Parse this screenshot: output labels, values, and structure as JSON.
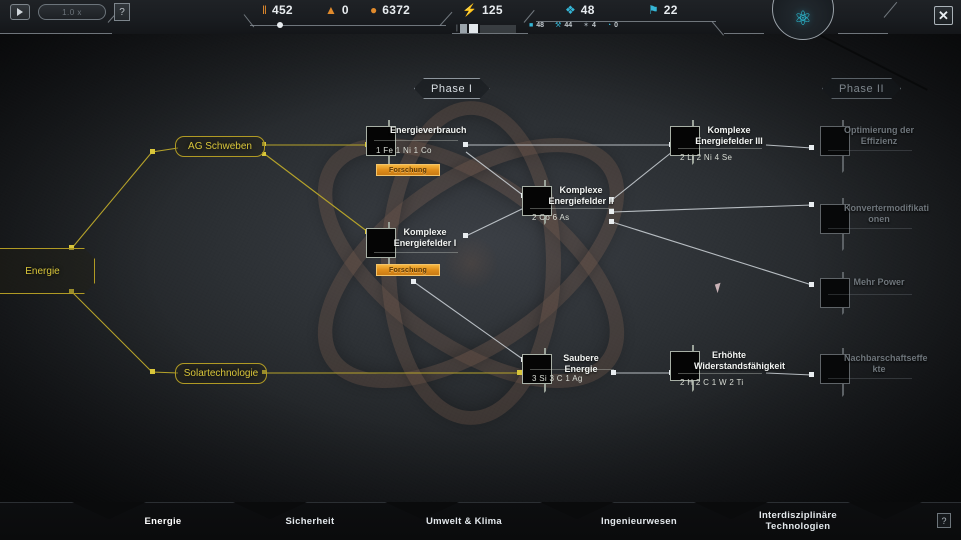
{
  "window": {
    "close_label": "✕",
    "help_label": "?"
  },
  "topbar": {
    "play_icon": "play-icon",
    "speed_value": "1.0 x",
    "help_label": "?",
    "resources": [
      {
        "icon": "population-icon",
        "glyph": "‖",
        "value": "452",
        "color": "#e08a2c"
      },
      {
        "icon": "flame-icon",
        "glyph": "▲",
        "value": "0",
        "color": "#d8841f"
      },
      {
        "icon": "coin-icon",
        "glyph": "●",
        "value": "6372",
        "color": "#d8a12a"
      },
      {
        "icon": "energy-icon",
        "glyph": "⚡",
        "value": "125",
        "color": "#d8a12a"
      },
      {
        "icon": "research-icon",
        "glyph": "❖",
        "value": "48",
        "color": "#35b6d6"
      },
      {
        "icon": "colonist-icon",
        "glyph": "⚑",
        "value": "22",
        "color": "#35b6d6"
      }
    ],
    "sub_resources": [
      {
        "icon": "cube-icon",
        "glyph": "■",
        "value": "48",
        "color": "#35b6d6"
      },
      {
        "icon": "wrench-icon",
        "glyph": "⚒",
        "value": "44",
        "color": "#35b6d6"
      },
      {
        "icon": "spark-icon",
        "glyph": "✶",
        "value": "4",
        "color": "#9aa3aa"
      },
      {
        "icon": "clock-icon",
        "glyph": "◔",
        "value": "0",
        "color": "#35b6d6"
      }
    ],
    "atom_badge_icon": "atom-icon",
    "atom_badge_glyph": "⚛"
  },
  "phases": [
    {
      "label": "Phase I",
      "state": "active"
    },
    {
      "label": "Phase II",
      "state": "locked"
    }
  ],
  "categories": [
    {
      "label": "Energie",
      "name": "category-energie"
    },
    {
      "label": "AG Schweben",
      "name": "category-ag-schweben"
    },
    {
      "label": "Solartechnologie",
      "name": "category-solartechnologie"
    }
  ],
  "tech_nodes": [
    {
      "name": "tech-energieverbrauch",
      "title": "Energieverbrauch",
      "cost": "1 Fe 1 Ni  1 Co",
      "button": "Forschung",
      "state": "available"
    },
    {
      "name": "tech-komplexe-energiefelder-1",
      "title": "Komplexe\nEnergiefelder I",
      "cost": "",
      "button": "Forschung",
      "state": "available"
    },
    {
      "name": "tech-komplexe-energiefelder-2",
      "title": "Komplexe\nEnergiefelder II",
      "cost": "2 Co  6 As",
      "button": "",
      "state": "available"
    },
    {
      "name": "tech-komplexe-energiefelder-3",
      "title": "Komplexe\nEnergiefelder III",
      "cost": "2 Li  2 Ni  4 Se",
      "button": "",
      "state": "available"
    },
    {
      "name": "tech-saubere-energie",
      "title": "Saubere Energie",
      "cost": "3 Si  3 C  1 Ag",
      "button": "",
      "state": "available"
    },
    {
      "name": "tech-erhoehte-widerstandsfaehigkeit",
      "title": "Erhöhte\nWiderstandsfähigkeit",
      "cost": "2 H  2 C  1 W  2 Ti",
      "button": "",
      "state": "available"
    },
    {
      "name": "tech-optimierung-der-effizienz",
      "title": "Optimierung der\nEffizienz",
      "cost": "",
      "button": "",
      "state": "locked"
    },
    {
      "name": "tech-konvertermodifikationen",
      "title": "Konvertermodifikati\nonen",
      "cost": "",
      "button": "",
      "state": "locked"
    },
    {
      "name": "tech-mehr-power",
      "title": "Mehr Power",
      "cost": "",
      "button": "",
      "state": "locked"
    },
    {
      "name": "tech-nachbarschaftseffekte",
      "title": "Nachbarschaftseffe\nkte",
      "cost": "",
      "button": "",
      "state": "locked"
    }
  ],
  "tabs": [
    {
      "label": "Energie",
      "active": true
    },
    {
      "label": "Sicherheit",
      "active": false
    },
    {
      "label": "Umwelt & Klima",
      "active": false
    },
    {
      "label": "Ingenieurwesen",
      "active": false
    },
    {
      "label": "Interdisziplinäre\nTechnologien",
      "active": false
    }
  ],
  "colors": {
    "accent_yellow": "#d9c63a",
    "research_orange": "#e08f1c",
    "cyan": "#35b6d6",
    "card_olive": "#56542e"
  }
}
